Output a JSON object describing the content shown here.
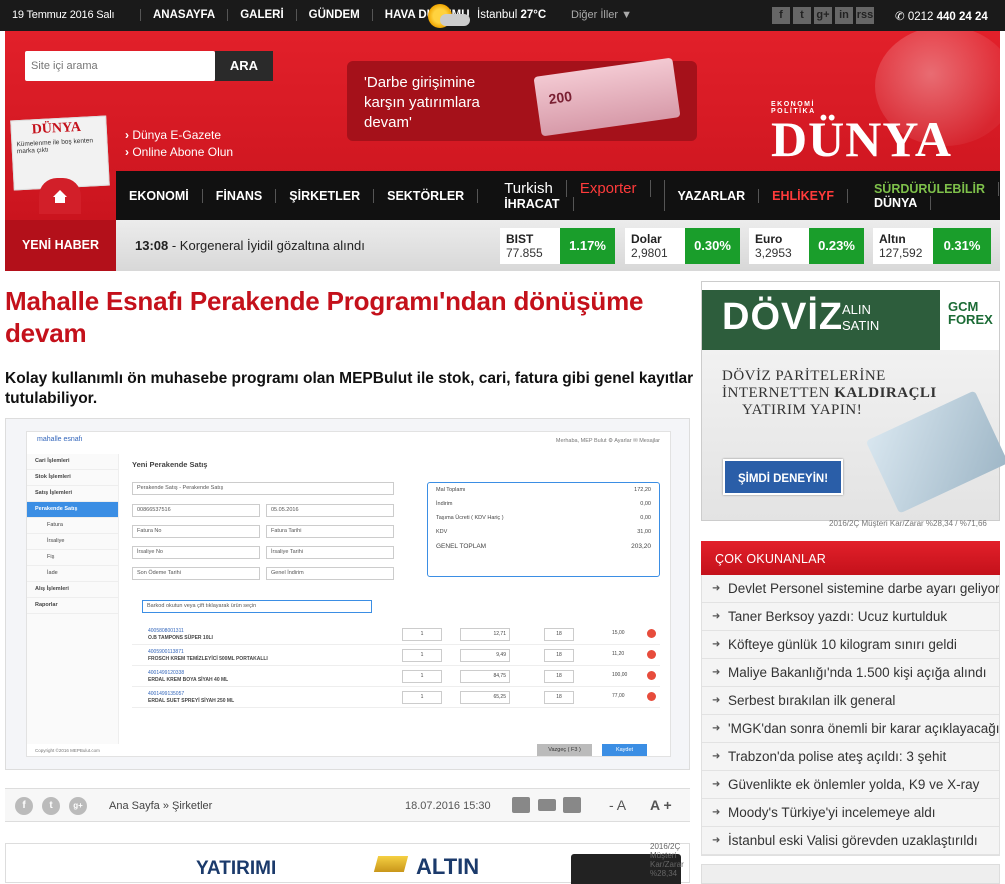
{
  "topbar": {
    "date": "19 Temmuz 2016 Salı",
    "nav": [
      "ANASAYFA",
      "GALERİ",
      "GÜNDEM",
      "HAVA DURUMU"
    ],
    "city": "İstanbul",
    "temp": "27°C",
    "others": "Diğer İller  ▼",
    "socials": [
      "f",
      "t",
      "g+",
      "in",
      "rss"
    ],
    "phone_prefix": "0212",
    "phone": "440 24 24"
  },
  "header": {
    "search_placeholder": "Site içi arama",
    "search_button": "ARA",
    "ad_text": "'Darbe girişimine karşın yatırımlara devam'",
    "money_label": "200",
    "newspaper_title": "DÜNYA",
    "newspaper_sub": "Kümelenme ile boş kenten marka çıktı",
    "egazete": "Dünya E-Gazete",
    "abone": "Online Abone Olun",
    "brand_small": "EKONOMİ  POLİTİKA",
    "brand": "DÜNYA",
    "nav2": [
      "EKONOMİ",
      "FİNANS",
      "ŞİRKETLER",
      "SEKTÖRLER"
    ],
    "turkish": "Turkish",
    "exporter": "Exporter",
    "ihracat": " İHRACAT",
    "yazarlar": "YAZARLAR",
    "ehlikeyf": "EHLİKEYF",
    "surdurulebilir": "SÜRDÜRÜLEBİLİR",
    "dunya": " DÜNYA"
  },
  "ticker": {
    "label": "YENİ HABER",
    "time": "13:08",
    "text": " - Korgeneral İyidil gözaltına alındı",
    "markets": [
      {
        "name": "BIST",
        "value": "77.855",
        "pct": "1.17%"
      },
      {
        "name": "Dolar",
        "value": "2,9801",
        "pct": "0.30%"
      },
      {
        "name": "Euro",
        "value": "3,2953",
        "pct": "0.23%"
      },
      {
        "name": "Altın",
        "value": "127,592",
        "pct": "0.31%"
      }
    ]
  },
  "article": {
    "title": "Mahalle Esnafı Perakende Programı'ndan dönüşüme devam",
    "lead": "Kolay kullanımlı ön muhasebe programı olan MEPBulut ile stok, cari, fatura gibi genel kayıtlar tutulabiliyor.",
    "breadcrumb": "Ana Sayfa  » Şirketler",
    "date": "18.07.2016 15:30",
    "font_minus": "- A",
    "font_plus": "A +"
  },
  "shot": {
    "logo": "mahalle esnafı",
    "user": "Merhaba, MEP Bulut   ⚙ Ayarlar   ✉ Mesajlar",
    "heading": "Yeni Perakende Satış",
    "side": [
      "Cari İşlemleri",
      "Stok İşlemleri",
      "Satış İşlemleri",
      "Perakende Satış",
      "Fatura",
      "İrsaliye",
      "Fiş",
      "İade",
      "Alış İşlemleri",
      "Raporlar"
    ],
    "fields": [
      "Perakende Satış - Perakende Satış",
      "00866537516",
      "05.05.2016",
      "Fatura No",
      "Fatura Tarihi",
      "İrsaliye No",
      "İrsaliye Tarihi",
      "Son Ödeme Tarihi",
      "Genel İndirim",
      "Barkod okutun veya çift tıklayarak ürün seçin"
    ],
    "summary": [
      {
        "k": "Mal Toplamı",
        "v": "172,20"
      },
      {
        "k": "İndirim",
        "v": "0,00"
      },
      {
        "k": "Taşıma Ücreti ( KDV Hariç )",
        "v": "0,00"
      },
      {
        "k": "KDV",
        "v": "31,00"
      },
      {
        "k": "GENEL TOPLAM",
        "v": "203,20"
      }
    ],
    "rows": [
      {
        "code": "4005808001311",
        "name": "O.B TAMPONS SÜPER 10LI",
        "qty": "1",
        "price": "12,71",
        "kdv": "18",
        "total": "15,00"
      },
      {
        "code": "4005900113871",
        "name": "FROSCH KREM TEMİZLEYİCİ 500ML PORTAKALLI",
        "qty": "1",
        "price": "9,49",
        "kdv": "18",
        "total": "11,20"
      },
      {
        "code": "4001499120338",
        "name": "ERDAL KREM BOYA SİYAH 40 ML",
        "qty": "1",
        "price": "84,75",
        "kdv": "18",
        "total": "100,00"
      },
      {
        "code": "4001499135057",
        "name": "ERDAL SUET SPREYİ SİYAH 250 ML",
        "qty": "1",
        "price": "65,25",
        "kdv": "18",
        "total": "77,00"
      }
    ],
    "btn_cancel": "Vazgeç ( F3 )",
    "btn_save": "Kaydet",
    "footer": "Copyright ©2016 MEPBulut.com"
  },
  "bottom_ads": {
    "a1": "YATIRIMI",
    "a2": "ALTIN",
    "note": "2016/2Ç Müşteri Kar/Zarar %28,34"
  },
  "right_ad": {
    "doviz": "DÖVİZ",
    "al": "ALIN",
    "sat": "SATIN",
    "gcm1": "GCM",
    "gcm2": "FOREX",
    "msg1": "DÖVİZ PARİTELERİNE",
    "msg2a": "İNTERNETTEN ",
    "msg2b": "KALDIRAÇLI",
    "msg3": "YATIRIM YAPIN!",
    "button": "ŞİMDİ DENEYİN!",
    "note": "2016/2Ç Müşteri Kar/Zarar %28,34  / %71,66"
  },
  "most_read": {
    "title": "ÇOK OKUNANLAR",
    "items": [
      "Devlet Personel sistemine darbe ayarı geliyor",
      "Taner Berksoy yazdı: Ucuz kurtulduk",
      "Köfteye günlük 10 kilogram sınırı geldi",
      "Maliye Bakanlığı'nda 1.500 kişi açığa alındı",
      "Serbest bırakılan ilk general",
      "'MGK'dan sonra önemli bir karar açıklayacağız'",
      "Trabzon'da polise ateş açıldı: 3 şehit",
      "Güvenlikte ek önlemler yolda, K9 ve X-ray",
      "Moody's Türkiye'yi incelemeye aldı",
      "İstanbul eski Valisi görevden uzaklaştırıldı"
    ]
  }
}
